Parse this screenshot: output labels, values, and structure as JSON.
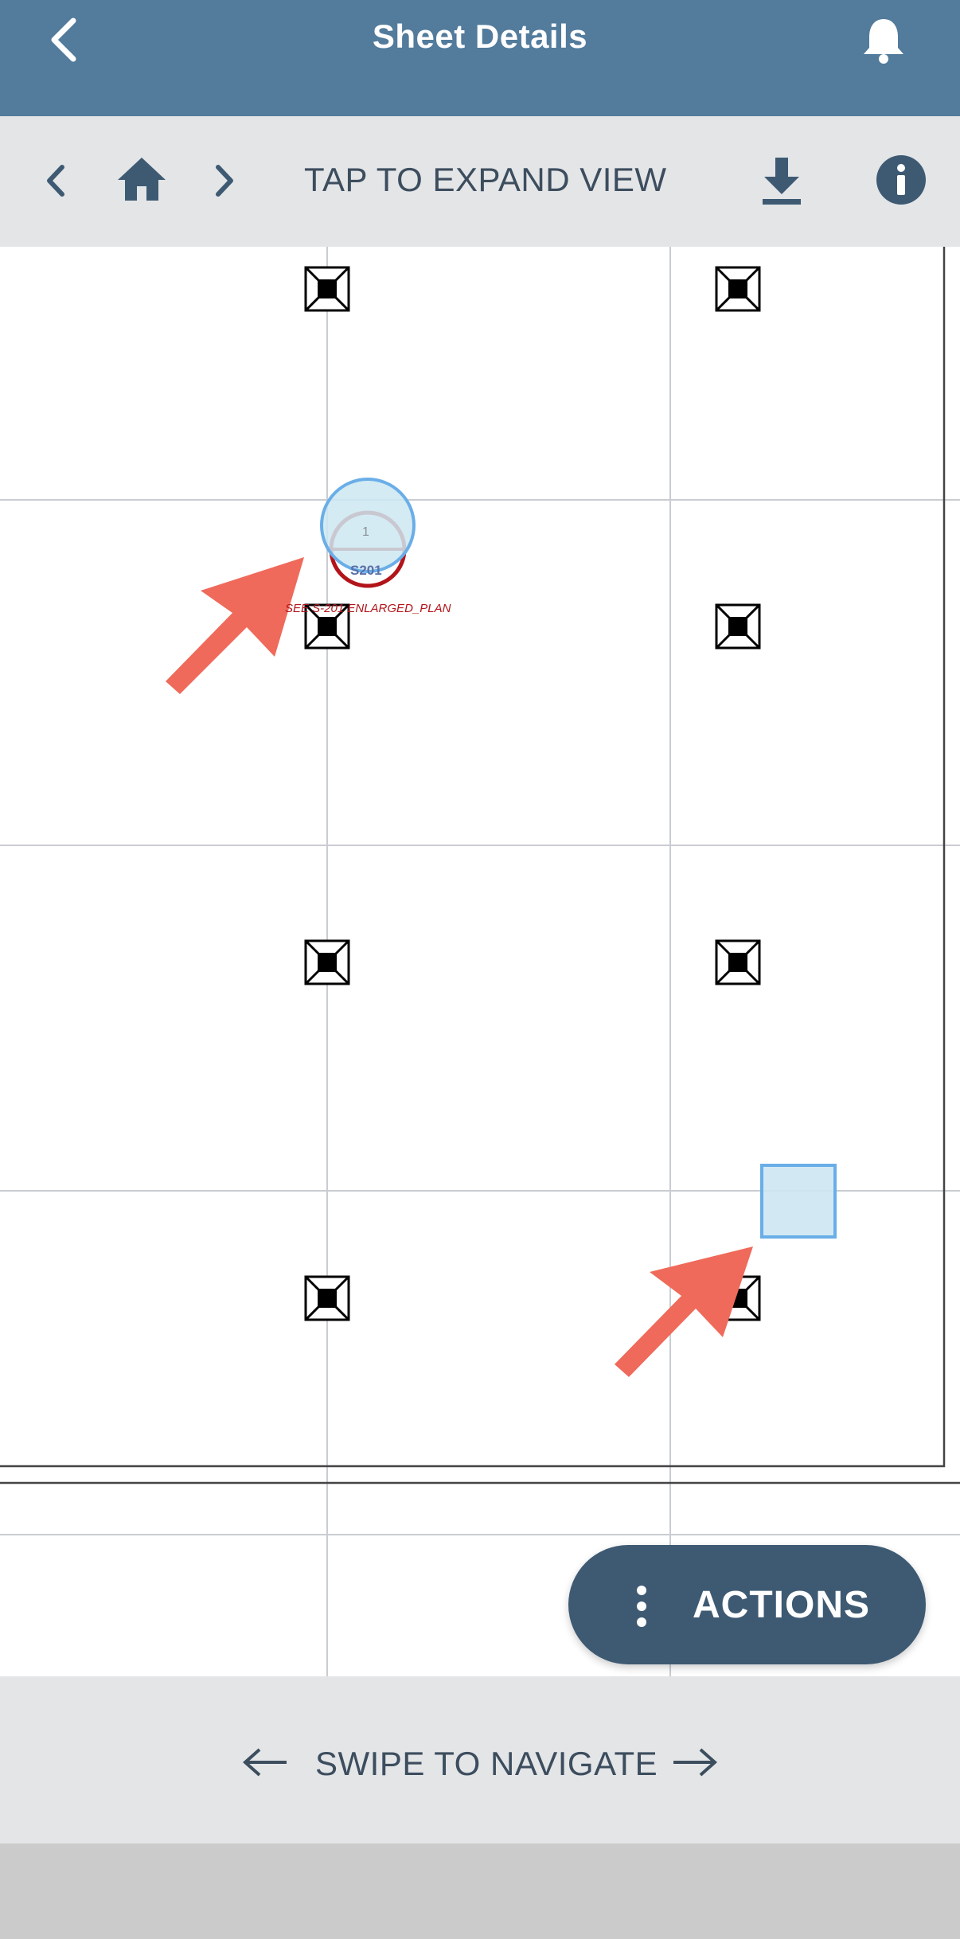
{
  "header": {
    "title": "Sheet Details",
    "back_icon": "chevron-left-icon",
    "notification_icon": "bell-icon"
  },
  "toolbar": {
    "prev_icon": "chevron-left-icon",
    "home_icon": "home-icon",
    "next_icon": "chevron-right-icon",
    "expand_label": "TAP TO EXPAND VIEW",
    "download_icon": "download-icon",
    "info_icon": "info-icon"
  },
  "sheet": {
    "callout": {
      "detail_number": "1",
      "sheet_ref": "S201",
      "label": "SEE S-201 ENLARGED_PLAN"
    }
  },
  "actions": {
    "label": "ACTIONS",
    "icon": "more-vertical-icon"
  },
  "footer": {
    "swipe_label": "SWIPE TO NAVIGATE",
    "left_arrow_icon": "arrow-left-icon",
    "right_arrow_icon": "arrow-right-icon"
  },
  "colors": {
    "header_bg": "#527b9c",
    "toolbar_bg": "#e4e5e7",
    "actions_bg": "#3e5a73",
    "annotation_arrow": "#ef6a5a",
    "markup_fill": "#cde7f2",
    "markup_stroke": "#6aaee8",
    "callout_red": "#b2141a"
  }
}
